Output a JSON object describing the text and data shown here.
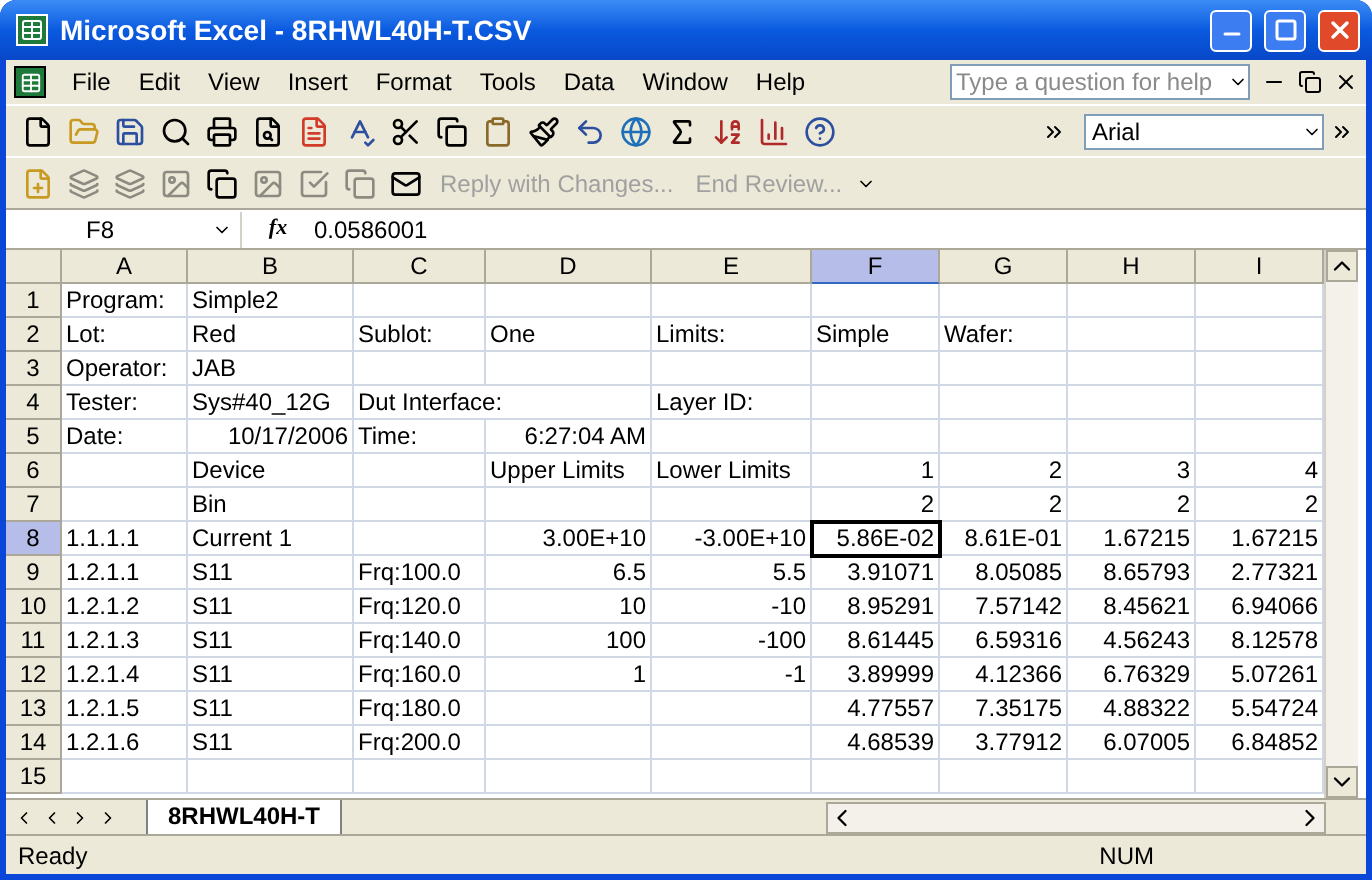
{
  "window": {
    "title": "Microsoft Excel - 8RHWL40H-T.CSV"
  },
  "menu": [
    "File",
    "Edit",
    "View",
    "Insert",
    "Format",
    "Tools",
    "Data",
    "Window",
    "Help"
  ],
  "help_box": {
    "placeholder": "Type a question for help"
  },
  "font_box": {
    "value": "Arial"
  },
  "review_toolbar": [
    {
      "label": "Reply with Changes...",
      "disabled": true
    },
    {
      "label": "End Review...",
      "disabled": true
    }
  ],
  "formula_bar": {
    "name_box": "F8",
    "fx": "fx",
    "value": "0.0586001"
  },
  "columns": [
    {
      "label": "A",
      "selected": false
    },
    {
      "label": "B",
      "selected": false
    },
    {
      "label": "C",
      "selected": false
    },
    {
      "label": "D",
      "selected": false
    },
    {
      "label": "E",
      "selected": false
    },
    {
      "label": "F",
      "selected": true
    },
    {
      "label": "G",
      "selected": false
    },
    {
      "label": "H",
      "selected": false
    },
    {
      "label": "I",
      "selected": false
    }
  ],
  "rows": [
    {
      "number": "1",
      "selected": false,
      "cells": [
        {
          "text": "Program:",
          "kind": "text"
        },
        {
          "text": "Simple2",
          "kind": "text"
        },
        null,
        null,
        null,
        null,
        null,
        null,
        null
      ]
    },
    {
      "number": "2",
      "selected": false,
      "cells": [
        {
          "text": "Lot:",
          "kind": "text"
        },
        {
          "text": "Red",
          "kind": "text"
        },
        {
          "text": "Sublot:",
          "kind": "text"
        },
        {
          "text": "One",
          "kind": "text"
        },
        {
          "text": "Limits:",
          "kind": "text"
        },
        {
          "text": "Simple",
          "kind": "text"
        },
        {
          "text": "Wafer:",
          "kind": "text"
        },
        null,
        null
      ]
    },
    {
      "number": "3",
      "selected": false,
      "cells": [
        {
          "text": "Operator:",
          "kind": "text"
        },
        {
          "text": "JAB",
          "kind": "text"
        },
        null,
        null,
        null,
        null,
        null,
        null,
        null
      ]
    },
    {
      "number": "4",
      "selected": false,
      "cells": [
        {
          "text": "Tester:",
          "kind": "text"
        },
        {
          "text": "Sys#40_12G",
          "kind": "text"
        },
        {
          "text": "Dut Interface:",
          "kind": "text"
        },
        null,
        {
          "text": "Layer ID:",
          "kind": "text"
        },
        null,
        null,
        null,
        null
      ]
    },
    {
      "number": "5",
      "selected": false,
      "cells": [
        {
          "text": "Date:",
          "kind": "text"
        },
        {
          "text": "10/17/2006",
          "kind": "number"
        },
        {
          "text": "Time:",
          "kind": "text"
        },
        {
          "text": "6:27:04 AM",
          "kind": "number"
        },
        null,
        null,
        null,
        null,
        null
      ]
    },
    {
      "number": "6",
      "selected": false,
      "cells": [
        null,
        {
          "text": "Device",
          "kind": "text"
        },
        null,
        {
          "text": "Upper Limits",
          "kind": "text"
        },
        {
          "text": "Lower Limits",
          "kind": "text"
        },
        {
          "text": "1",
          "kind": "number"
        },
        {
          "text": "2",
          "kind": "number"
        },
        {
          "text": "3",
          "kind": "number"
        },
        {
          "text": "4",
          "kind": "number"
        }
      ]
    },
    {
      "number": "7",
      "selected": false,
      "cells": [
        null,
        {
          "text": "Bin",
          "kind": "text"
        },
        null,
        null,
        null,
        {
          "text": "2",
          "kind": "number"
        },
        {
          "text": "2",
          "kind": "number"
        },
        {
          "text": "2",
          "kind": "number"
        },
        {
          "text": "2",
          "kind": "number"
        }
      ]
    },
    {
      "number": "8",
      "selected": true,
      "cells": [
        {
          "text": "1.1.1.1",
          "kind": "text"
        },
        {
          "text": "Current 1",
          "kind": "text"
        },
        null,
        {
          "text": "3.00E+10",
          "kind": "number"
        },
        {
          "text": "-3.00E+10",
          "kind": "number"
        },
        {
          "text": "5.86E-02",
          "kind": "number",
          "active": true
        },
        {
          "text": "8.61E-01",
          "kind": "number"
        },
        {
          "text": "1.67215",
          "kind": "number"
        },
        {
          "text": "1.67215",
          "kind": "number"
        }
      ]
    },
    {
      "number": "9",
      "selected": false,
      "cells": [
        {
          "text": "1.2.1.1",
          "kind": "text"
        },
        {
          "text": "S11",
          "kind": "text"
        },
        {
          "text": "Frq:100.0",
          "kind": "text"
        },
        {
          "text": "6.5",
          "kind": "number"
        },
        {
          "text": "5.5",
          "kind": "number"
        },
        {
          "text": "3.91071",
          "kind": "number"
        },
        {
          "text": "8.05085",
          "kind": "number"
        },
        {
          "text": "8.65793",
          "kind": "number"
        },
        {
          "text": "2.77321",
          "kind": "number"
        }
      ]
    },
    {
      "number": "10",
      "selected": false,
      "cells": [
        {
          "text": "1.2.1.2",
          "kind": "text"
        },
        {
          "text": "S11",
          "kind": "text"
        },
        {
          "text": "Frq:120.0",
          "kind": "text"
        },
        {
          "text": "10",
          "kind": "number"
        },
        {
          "text": "-10",
          "kind": "number"
        },
        {
          "text": "8.95291",
          "kind": "number"
        },
        {
          "text": "7.57142",
          "kind": "number"
        },
        {
          "text": "8.45621",
          "kind": "number"
        },
        {
          "text": "6.94066",
          "kind": "number"
        }
      ]
    },
    {
      "number": "11",
      "selected": false,
      "cells": [
        {
          "text": "1.2.1.3",
          "kind": "text"
        },
        {
          "text": "S11",
          "kind": "text"
        },
        {
          "text": "Frq:140.0",
          "kind": "text"
        },
        {
          "text": "100",
          "kind": "number"
        },
        {
          "text": "-100",
          "kind": "number"
        },
        {
          "text": "8.61445",
          "kind": "number"
        },
        {
          "text": "6.59316",
          "kind": "number"
        },
        {
          "text": "4.56243",
          "kind": "number"
        },
        {
          "text": "8.12578",
          "kind": "number"
        }
      ]
    },
    {
      "number": "12",
      "selected": false,
      "cells": [
        {
          "text": "1.2.1.4",
          "kind": "text"
        },
        {
          "text": "S11",
          "kind": "text"
        },
        {
          "text": "Frq:160.0",
          "kind": "text"
        },
        {
          "text": "1",
          "kind": "number"
        },
        {
          "text": "-1",
          "kind": "number"
        },
        {
          "text": "3.89999",
          "kind": "number"
        },
        {
          "text": "4.12366",
          "kind": "number"
        },
        {
          "text": "6.76329",
          "kind": "number"
        },
        {
          "text": "5.07261",
          "kind": "number"
        }
      ]
    },
    {
      "number": "13",
      "selected": false,
      "cells": [
        {
          "text": "1.2.1.5",
          "kind": "text"
        },
        {
          "text": "S11",
          "kind": "text"
        },
        {
          "text": "Frq:180.0",
          "kind": "text"
        },
        null,
        null,
        {
          "text": "4.77557",
          "kind": "number"
        },
        {
          "text": "7.35175",
          "kind": "number"
        },
        {
          "text": "4.88322",
          "kind": "number"
        },
        {
          "text": "5.54724",
          "kind": "number"
        }
      ]
    },
    {
      "number": "14",
      "selected": false,
      "cells": [
        {
          "text": "1.2.1.6",
          "kind": "text"
        },
        {
          "text": "S11",
          "kind": "text"
        },
        {
          "text": "Frq:200.0",
          "kind": "text"
        },
        null,
        null,
        {
          "text": "4.68539",
          "kind": "number"
        },
        {
          "text": "3.77912",
          "kind": "number"
        },
        {
          "text": "6.07005",
          "kind": "number"
        },
        {
          "text": "6.84852",
          "kind": "number"
        }
      ]
    },
    {
      "number": "15",
      "selected": false,
      "cells": [
        null,
        null,
        null,
        null,
        null,
        null,
        null,
        null,
        null
      ]
    }
  ],
  "sheet_tabs": [
    {
      "label": "8RHWL40H-T",
      "selected": true
    }
  ],
  "status_bar": {
    "status": "Ready",
    "indicator": "NUM"
  }
}
